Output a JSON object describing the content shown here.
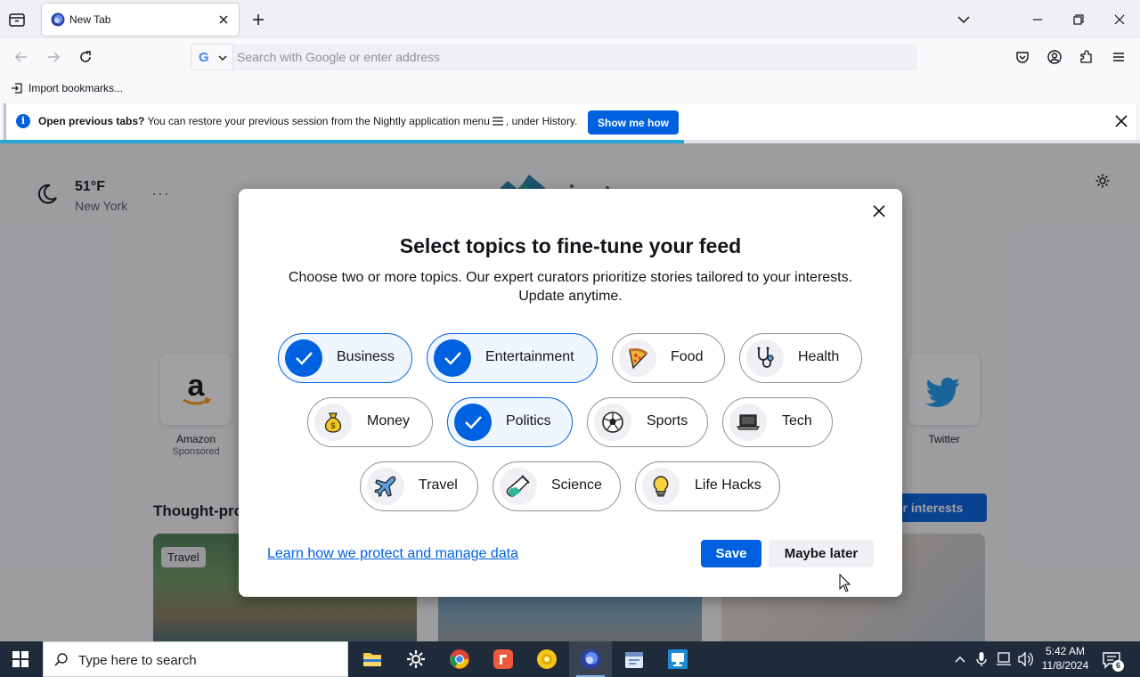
{
  "browser": {
    "tab": {
      "title": "New Tab"
    },
    "urlbar": {
      "engine_letter": "G",
      "placeholder": "Search with Google or enter address"
    },
    "bookmarks": {
      "import_label": "Import bookmarks..."
    },
    "notification": {
      "bold": "Open previous tabs?",
      "text_before": " You can restore your previous session from the Nightly application menu",
      "text_after": ", under History.",
      "button": "Show me how",
      "progress_fraction": 0.6
    }
  },
  "newtab": {
    "weather": {
      "temperature": "51°F",
      "city": "New York",
      "more": "···"
    },
    "shortcuts": [
      {
        "label": "Amazon",
        "sublabel": "Sponsored",
        "glyph": "a"
      },
      {
        "label": "Twitter",
        "sublabel": "",
        "glyph": "twitter-bird"
      }
    ],
    "section_title": "Thought-pro",
    "interests_button": "ur interests",
    "card_tag": "Travel"
  },
  "modal": {
    "title": "Select topics to fine-tune your feed",
    "subtitle_line1": "Choose two or more topics. Our expert curators prioritize stories tailored to your interests.",
    "subtitle_line2": "Update anytime.",
    "topics": [
      {
        "label": "Business",
        "selected": true,
        "icon": "check-icon"
      },
      {
        "label": "Entertainment",
        "selected": true,
        "icon": "check-icon"
      },
      {
        "label": "Food",
        "selected": false,
        "icon": "pizza-icon"
      },
      {
        "label": "Health",
        "selected": false,
        "icon": "stethoscope-icon"
      },
      {
        "label": "Money",
        "selected": false,
        "icon": "money-bag-icon"
      },
      {
        "label": "Politics",
        "selected": true,
        "icon": "check-icon"
      },
      {
        "label": "Sports",
        "selected": false,
        "icon": "soccer-ball-icon"
      },
      {
        "label": "Tech",
        "selected": false,
        "icon": "laptop-icon"
      },
      {
        "label": "Travel",
        "selected": false,
        "icon": "airplane-icon"
      },
      {
        "label": "Science",
        "selected": false,
        "icon": "test-tube-icon"
      },
      {
        "label": "Life Hacks",
        "selected": false,
        "icon": "lightbulb-icon"
      }
    ],
    "learn_link": "Learn how we protect and manage data",
    "save_button": "Save",
    "later_button": "Maybe later"
  },
  "taskbar": {
    "search_placeholder": "Type here to search",
    "time": "5:42 AM",
    "date": "11/8/2024",
    "notification_count": "6"
  },
  "colors": {
    "accent": "#0061e0",
    "taskbar": "#1f2a3a",
    "selected_pill_bg": "#f0f6ff"
  }
}
